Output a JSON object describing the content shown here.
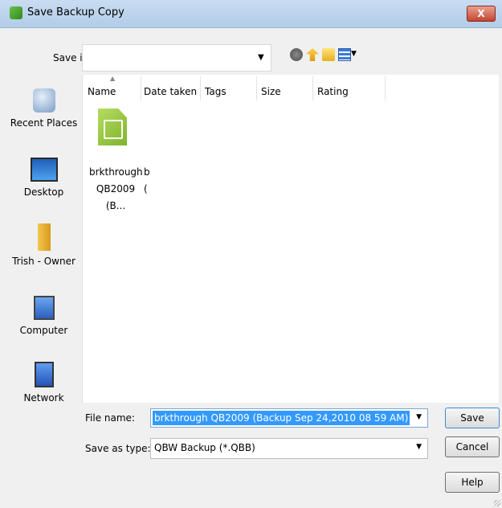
{
  "window": {
    "title": "Save Backup Copy",
    "close_label": "X"
  },
  "save_in": {
    "label": "Save in:",
    "value": ""
  },
  "toolbar_icons": [
    "back-icon",
    "up-folder-icon",
    "new-folder-icon",
    "views-icon"
  ],
  "places": [
    {
      "label": "Recent Places",
      "icon": "recent-places-icon"
    },
    {
      "label": "Desktop",
      "icon": "desktop-icon"
    },
    {
      "label": "Trish - Owner",
      "icon": "user-folder-icon"
    },
    {
      "label": "Computer",
      "icon": "computer-icon"
    },
    {
      "label": "Network",
      "icon": "network-icon"
    }
  ],
  "columns": [
    "Name",
    "Date taken",
    "Tags",
    "Size",
    "Rating"
  ],
  "files": [
    {
      "name_line1": "brkthrough",
      "name_line2": "QB2009 (B...",
      "cut_line1": "b",
      "cut_line2": "("
    }
  ],
  "form": {
    "file_name_label": "File name:",
    "file_name_value": "brkthrough QB2009 (Backup Sep 24,2010  08 59 AM)",
    "save_type_label": "Save as type:",
    "save_type_value": "QBW Backup (*.QBB)"
  },
  "buttons": {
    "save": "Save",
    "cancel": "Cancel",
    "help": "Help"
  },
  "colors": {
    "title_bar": "#b2cce8",
    "selection": "#3399ff",
    "file_icon": "#8fc23a"
  }
}
